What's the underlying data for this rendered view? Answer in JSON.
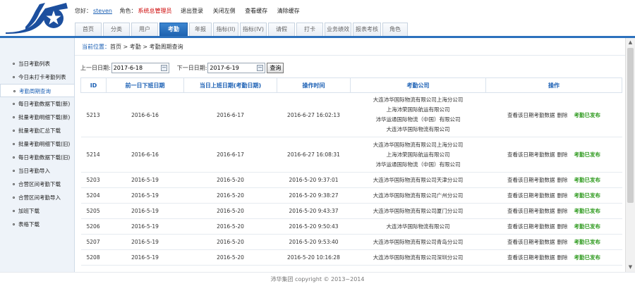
{
  "header": {
    "greeting_label": "您好：",
    "username": "steven",
    "role_label": "角色：",
    "role": "系统总管理员",
    "links": [
      "退出登录",
      "关闭左侧",
      "查看缓存",
      "清除缓存"
    ]
  },
  "nav": {
    "tabs": [
      "首页",
      "分类",
      "用户",
      "考勤",
      "年报",
      "指标(II)",
      "指标(IV)",
      "请假",
      "打卡",
      "业务绩效",
      "报表考核",
      "角色"
    ],
    "active_index": 3
  },
  "sidebar": {
    "items": [
      "当日考勤列表",
      "今日未打卡考勤列表",
      "考勤周期查询",
      "每日考勤数据下载(新)",
      "批量考勤明细下载(新)",
      "批量考勤汇总下载",
      "批量考勤明细下载(旧)",
      "每日考勤数据下载(旧)",
      "当日考勤导入",
      "合营区间考勤下载",
      "合营区间考勤导入",
      "加班下载",
      "表格下载"
    ],
    "active_index": 2
  },
  "breadcrumb": {
    "label": "当前位置：",
    "path": "首页 > 考勤 > 考勤周期查询"
  },
  "filter": {
    "prev_label": "上一日日期:",
    "prev_value": "2017-6-18",
    "next_label": "下一日日期:",
    "next_value": "2017-6-19",
    "query_button": "查询"
  },
  "table": {
    "headers": [
      "ID",
      "前一日下班日期",
      "当日上班日期(考勤日期)",
      "操作时间",
      "考勤公司",
      "操作"
    ],
    "op_view": "查看该日期考勤数据",
    "op_delete": "删除",
    "op_status": "考勤已发布",
    "rows": [
      {
        "id": "5213",
        "prev": "2016-6-16",
        "curr": "2016-6-17",
        "time": "2016-6-27 16:02:13",
        "companies": [
          "大连沛华国际物流有限公司上海分公司",
          "上海沛荣国际航运有限公司",
          "沛华运通国际物流（中国）有限公司",
          "大连沛华国际物流有限公司"
        ]
      },
      {
        "id": "5214",
        "prev": "2016-6-16",
        "curr": "2016-6-17",
        "time": "2016-6-27 16:08:31",
        "companies": [
          "大连沛华国际物流有限公司上海分公司",
          "上海沛荣国际航运有限公司",
          "沛华运通国际物流（中国）有限公司"
        ]
      },
      {
        "id": "5203",
        "prev": "2016-5-19",
        "curr": "2016-5-20",
        "time": "2016-5-20 9:37:01",
        "companies": [
          "大连沛华国际物流有限公司天津分公司"
        ]
      },
      {
        "id": "5204",
        "prev": "2016-5-19",
        "curr": "2016-5-20",
        "time": "2016-5-20 9:38:27",
        "companies": [
          "大连沛华国际物流有限公司广州分公司"
        ]
      },
      {
        "id": "5205",
        "prev": "2016-5-19",
        "curr": "2016-5-20",
        "time": "2016-5-20 9:43:37",
        "companies": [
          "大连沛华国际物流有限公司厦门分公司"
        ]
      },
      {
        "id": "5206",
        "prev": "2016-5-19",
        "curr": "2016-5-20",
        "time": "2016-5-20 9:50:43",
        "companies": [
          "大连沛华国际物流有限公司"
        ]
      },
      {
        "id": "5207",
        "prev": "2016-5-19",
        "curr": "2016-5-20",
        "time": "2016-5-20 9:53:40",
        "companies": [
          "大连沛华国际物流有限公司青岛分公司"
        ]
      },
      {
        "id": "5208",
        "prev": "2016-5-19",
        "curr": "2016-5-20",
        "time": "2016-5-20 10:16:28",
        "companies": [
          "大连沛华国际物流有限公司深圳分公司"
        ]
      }
    ]
  },
  "footer": {
    "text": "沛华集团 copyright © 2013~2014"
  },
  "colors": {
    "brand_blue": "#1c60ad",
    "publish_green": "#2e9a1e",
    "role_red": "#cc0000"
  },
  "icons": [
    "logo-star-icon",
    "calendar-icon",
    "bullet-icon",
    "scroll-up-icon",
    "scroll-down-icon"
  ]
}
